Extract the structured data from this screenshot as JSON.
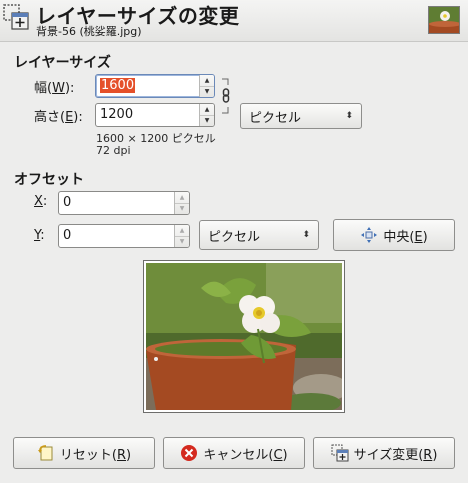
{
  "header": {
    "title": "レイヤーサイズの変更",
    "subtitle": "背景-56 (桃娑羅.jpg)"
  },
  "layer_size": {
    "section_title": "レイヤーサイズ",
    "width_label": "幅(W):",
    "width_label_pre": "幅(",
    "width_label_key": "W",
    "width_label_post": "):",
    "width_value": "1600",
    "height_label_pre": "高さ(",
    "height_label_key": "E",
    "height_label_post": "):",
    "height_value": "1200",
    "unit": "ピクセル",
    "size_info": "1600 × 1200 ピクセル",
    "dpi_info": "72 dpi"
  },
  "offset": {
    "section_title": "オフセット",
    "x_label_key": "X",
    "x_label_post": ":",
    "x_value": "0",
    "y_label_key": "Y",
    "y_label_post": ":",
    "y_value": "0",
    "unit": "ピクセル",
    "center_button": "中央(E)",
    "center_pre": "中央(",
    "center_key": "E",
    "center_post": ")"
  },
  "buttons": {
    "reset_pre": "リセット(",
    "reset_key": "R",
    "reset_post": ")",
    "cancel_pre": "キャンセル(",
    "cancel_key": "C",
    "cancel_post": ")",
    "resize_pre": "サイズ変更(",
    "resize_key": "R",
    "resize_post": ")"
  },
  "icons": {
    "header": "layer-resize-icon",
    "chain": "chain-link-icon",
    "center": "center-arrows-icon",
    "reset": "reset-icon",
    "cancel": "cancel-icon",
    "resize": "layer-resize-icon"
  },
  "colors": {
    "selection": "#e5502a",
    "cancel_icon": "#d42a1f",
    "window_bg": "#ededec"
  }
}
